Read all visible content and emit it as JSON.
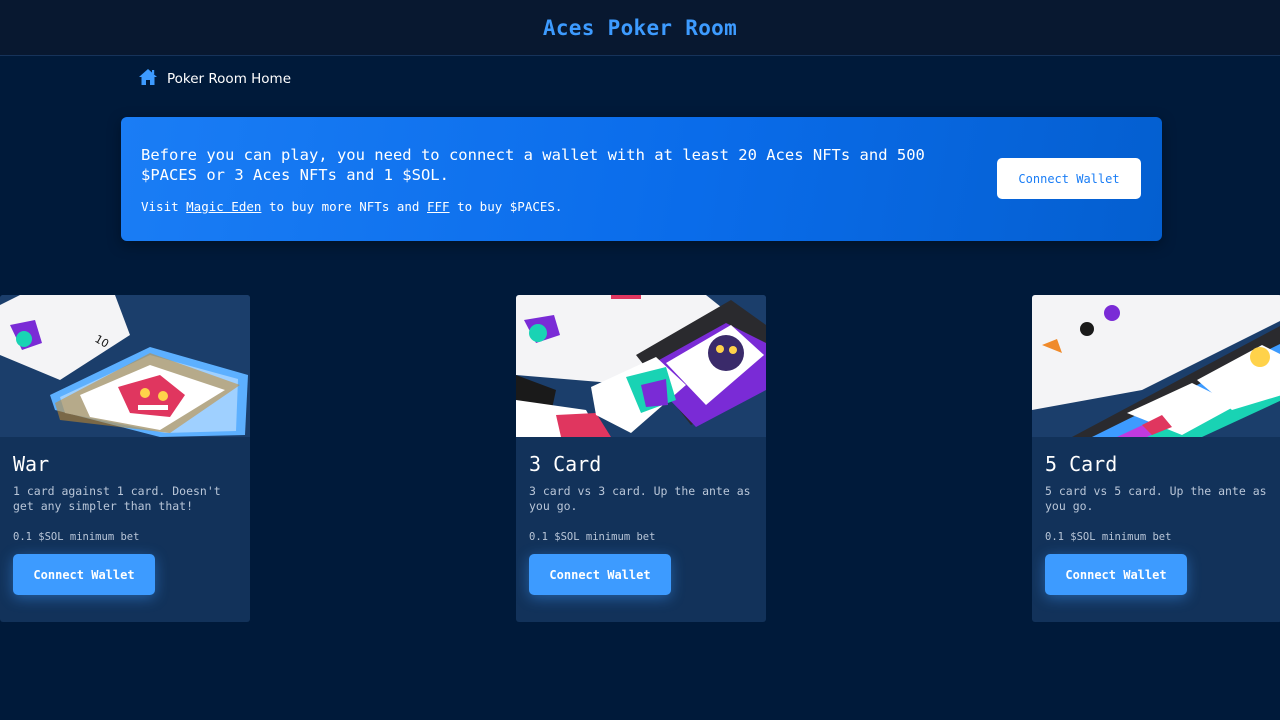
{
  "app": {
    "title": "Aces Poker Room"
  },
  "breadcrumb": {
    "icon": "home-icon",
    "label": "Poker Room Home"
  },
  "banner": {
    "message": "Before you can play, you need to connect a wallet with at least 20 Aces NFTs and 500 $PACES or 3 Aces NFTs and 1 $SOL.",
    "sub_prefix": "Visit ",
    "link1": "Magic Eden",
    "sub_middle": " to buy more NFTs and ",
    "link2": "FFF",
    "sub_suffix": " to buy $PACES.",
    "button": "Connect Wallet"
  },
  "games": [
    {
      "name": "War",
      "description": "1 card against 1 card. Doesn't get any simpler than that!",
      "bet": "0.1 $SOL minimum bet",
      "button": "Connect Wallet"
    },
    {
      "name": "3 Card",
      "description": "3 card vs 3 card. Up the ante as you go.",
      "bet": "0.1 $SOL minimum bet",
      "button": "Connect Wallet"
    },
    {
      "name": "5 Card",
      "description": "5 card vs 5 card. Up the ante as you go.",
      "bet": "0.1 $SOL minimum bet",
      "button": "Connect Wallet"
    }
  ],
  "colors": {
    "accent": "#3d9bff",
    "background": "#001a3a",
    "banner": "#0a6cea",
    "card": "#12325a"
  }
}
